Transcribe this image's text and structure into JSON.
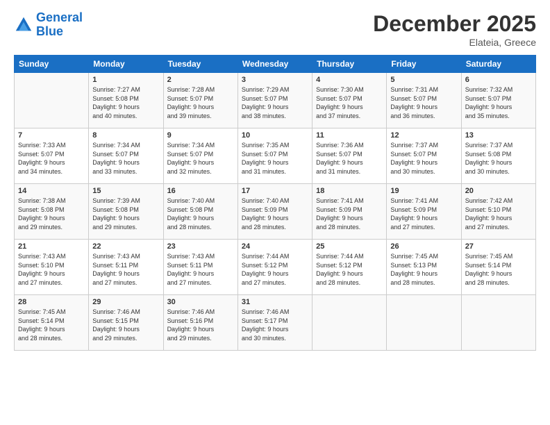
{
  "header": {
    "logo_line1": "General",
    "logo_line2": "Blue",
    "month": "December 2025",
    "location": "Elateia, Greece"
  },
  "days_of_week": [
    "Sunday",
    "Monday",
    "Tuesday",
    "Wednesday",
    "Thursday",
    "Friday",
    "Saturday"
  ],
  "weeks": [
    [
      {
        "day": "",
        "info": ""
      },
      {
        "day": "1",
        "info": "Sunrise: 7:27 AM\nSunset: 5:08 PM\nDaylight: 9 hours\nand 40 minutes."
      },
      {
        "day": "2",
        "info": "Sunrise: 7:28 AM\nSunset: 5:07 PM\nDaylight: 9 hours\nand 39 minutes."
      },
      {
        "day": "3",
        "info": "Sunrise: 7:29 AM\nSunset: 5:07 PM\nDaylight: 9 hours\nand 38 minutes."
      },
      {
        "day": "4",
        "info": "Sunrise: 7:30 AM\nSunset: 5:07 PM\nDaylight: 9 hours\nand 37 minutes."
      },
      {
        "day": "5",
        "info": "Sunrise: 7:31 AM\nSunset: 5:07 PM\nDaylight: 9 hours\nand 36 minutes."
      },
      {
        "day": "6",
        "info": "Sunrise: 7:32 AM\nSunset: 5:07 PM\nDaylight: 9 hours\nand 35 minutes."
      }
    ],
    [
      {
        "day": "7",
        "info": "Sunrise: 7:33 AM\nSunset: 5:07 PM\nDaylight: 9 hours\nand 34 minutes."
      },
      {
        "day": "8",
        "info": "Sunrise: 7:34 AM\nSunset: 5:07 PM\nDaylight: 9 hours\nand 33 minutes."
      },
      {
        "day": "9",
        "info": "Sunrise: 7:34 AM\nSunset: 5:07 PM\nDaylight: 9 hours\nand 32 minutes."
      },
      {
        "day": "10",
        "info": "Sunrise: 7:35 AM\nSunset: 5:07 PM\nDaylight: 9 hours\nand 31 minutes."
      },
      {
        "day": "11",
        "info": "Sunrise: 7:36 AM\nSunset: 5:07 PM\nDaylight: 9 hours\nand 31 minutes."
      },
      {
        "day": "12",
        "info": "Sunrise: 7:37 AM\nSunset: 5:07 PM\nDaylight: 9 hours\nand 30 minutes."
      },
      {
        "day": "13",
        "info": "Sunrise: 7:37 AM\nSunset: 5:08 PM\nDaylight: 9 hours\nand 30 minutes."
      }
    ],
    [
      {
        "day": "14",
        "info": "Sunrise: 7:38 AM\nSunset: 5:08 PM\nDaylight: 9 hours\nand 29 minutes."
      },
      {
        "day": "15",
        "info": "Sunrise: 7:39 AM\nSunset: 5:08 PM\nDaylight: 9 hours\nand 29 minutes."
      },
      {
        "day": "16",
        "info": "Sunrise: 7:40 AM\nSunset: 5:08 PM\nDaylight: 9 hours\nand 28 minutes."
      },
      {
        "day": "17",
        "info": "Sunrise: 7:40 AM\nSunset: 5:09 PM\nDaylight: 9 hours\nand 28 minutes."
      },
      {
        "day": "18",
        "info": "Sunrise: 7:41 AM\nSunset: 5:09 PM\nDaylight: 9 hours\nand 28 minutes."
      },
      {
        "day": "19",
        "info": "Sunrise: 7:41 AM\nSunset: 5:09 PM\nDaylight: 9 hours\nand 27 minutes."
      },
      {
        "day": "20",
        "info": "Sunrise: 7:42 AM\nSunset: 5:10 PM\nDaylight: 9 hours\nand 27 minutes."
      }
    ],
    [
      {
        "day": "21",
        "info": "Sunrise: 7:43 AM\nSunset: 5:10 PM\nDaylight: 9 hours\nand 27 minutes."
      },
      {
        "day": "22",
        "info": "Sunrise: 7:43 AM\nSunset: 5:11 PM\nDaylight: 9 hours\nand 27 minutes."
      },
      {
        "day": "23",
        "info": "Sunrise: 7:43 AM\nSunset: 5:11 PM\nDaylight: 9 hours\nand 27 minutes."
      },
      {
        "day": "24",
        "info": "Sunrise: 7:44 AM\nSunset: 5:12 PM\nDaylight: 9 hours\nand 27 minutes."
      },
      {
        "day": "25",
        "info": "Sunrise: 7:44 AM\nSunset: 5:12 PM\nDaylight: 9 hours\nand 28 minutes."
      },
      {
        "day": "26",
        "info": "Sunrise: 7:45 AM\nSunset: 5:13 PM\nDaylight: 9 hours\nand 28 minutes."
      },
      {
        "day": "27",
        "info": "Sunrise: 7:45 AM\nSunset: 5:14 PM\nDaylight: 9 hours\nand 28 minutes."
      }
    ],
    [
      {
        "day": "28",
        "info": "Sunrise: 7:45 AM\nSunset: 5:14 PM\nDaylight: 9 hours\nand 28 minutes."
      },
      {
        "day": "29",
        "info": "Sunrise: 7:46 AM\nSunset: 5:15 PM\nDaylight: 9 hours\nand 29 minutes."
      },
      {
        "day": "30",
        "info": "Sunrise: 7:46 AM\nSunset: 5:16 PM\nDaylight: 9 hours\nand 29 minutes."
      },
      {
        "day": "31",
        "info": "Sunrise: 7:46 AM\nSunset: 5:17 PM\nDaylight: 9 hours\nand 30 minutes."
      },
      {
        "day": "",
        "info": ""
      },
      {
        "day": "",
        "info": ""
      },
      {
        "day": "",
        "info": ""
      }
    ]
  ]
}
